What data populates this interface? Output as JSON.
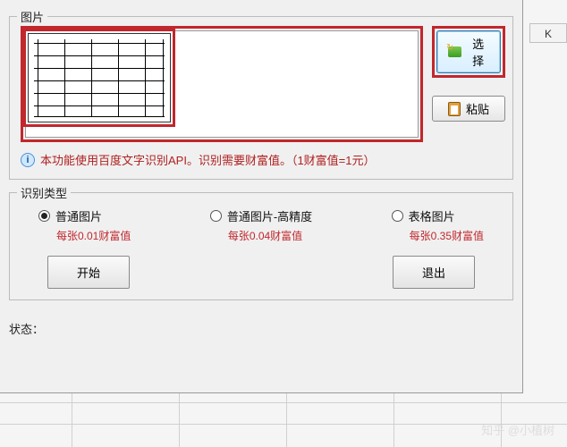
{
  "groups": {
    "image_label": "图片",
    "type_label": "识别类型"
  },
  "buttons": {
    "select": "选择",
    "paste": "粘贴",
    "start": "开始",
    "exit": "退出"
  },
  "info": "本功能使用百度文字识别API。识别需要财富值。（1财富值=1元）",
  "options": [
    {
      "label": "普通图片",
      "price": "每张0.01财富值",
      "checked": true
    },
    {
      "label": "普通图片-高精度",
      "price": "每张0.04财富值",
      "checked": false
    },
    {
      "label": "表格图片",
      "price": "每张0.35财富值",
      "checked": false
    }
  ],
  "status_label": "状态：",
  "column_header": "K",
  "watermark": "知乎 @小植树"
}
